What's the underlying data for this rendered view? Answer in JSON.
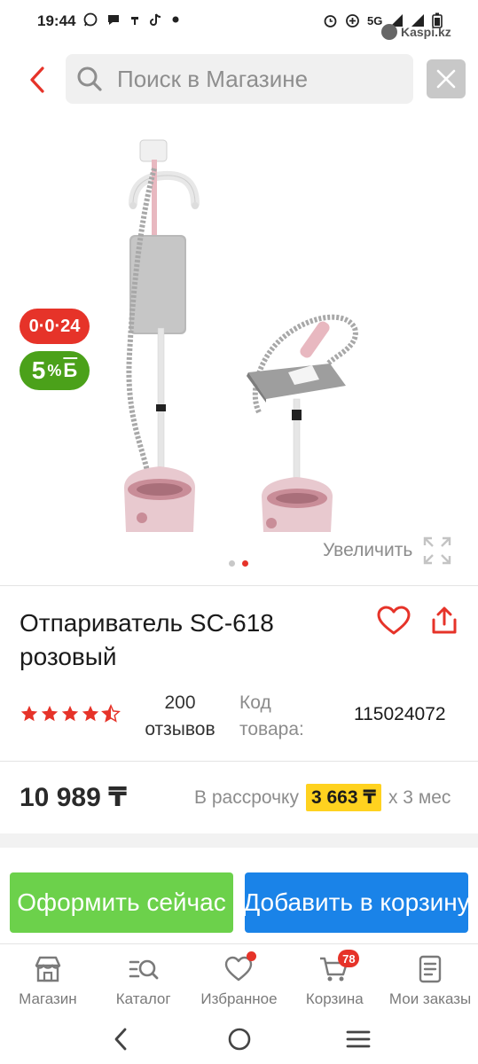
{
  "status_bar": {
    "time": "19:44",
    "network": "5G",
    "watermark": "Kaspi.kz"
  },
  "header": {
    "search_placeholder": "Поиск в Магазине"
  },
  "gallery": {
    "badge_credit": "0·0·24",
    "badge_bonus_value": "5",
    "badge_bonus_pct": "%",
    "badge_bonus_b": "Б",
    "zoom_label": "Увеличить",
    "slides_total": 2,
    "active_slide": 2
  },
  "product": {
    "title": "Отпариватель SC-618 розовый",
    "rating_stars": 4.5,
    "reviews_count": "200",
    "reviews_label": "отзывов",
    "code_label": "Код товара:",
    "code_value": "115024072",
    "price": "10 989 ₸",
    "installment_prefix": "В рассрочку",
    "installment_amount": "3 663 ₸",
    "installment_suffix": "x 3 мес"
  },
  "actions": {
    "buy_now": "Оформить сейчас",
    "add_to_cart": "Добавить в корзину"
  },
  "bottom_nav": {
    "items": [
      {
        "label": "Магазин",
        "icon": "store-icon"
      },
      {
        "label": "Каталог",
        "icon": "catalog-search-icon"
      },
      {
        "label": "Избранное",
        "icon": "heart-icon"
      },
      {
        "label": "Корзина",
        "icon": "cart-icon",
        "badge": "78"
      },
      {
        "label": "Мои заказы",
        "icon": "orders-icon"
      }
    ]
  },
  "colors": {
    "brand_red": "#e63329",
    "bonus_green": "#4ba11a",
    "buy_green": "#6cd14b",
    "cart_blue": "#1a83e8",
    "installment_yellow": "#ffd21f"
  }
}
